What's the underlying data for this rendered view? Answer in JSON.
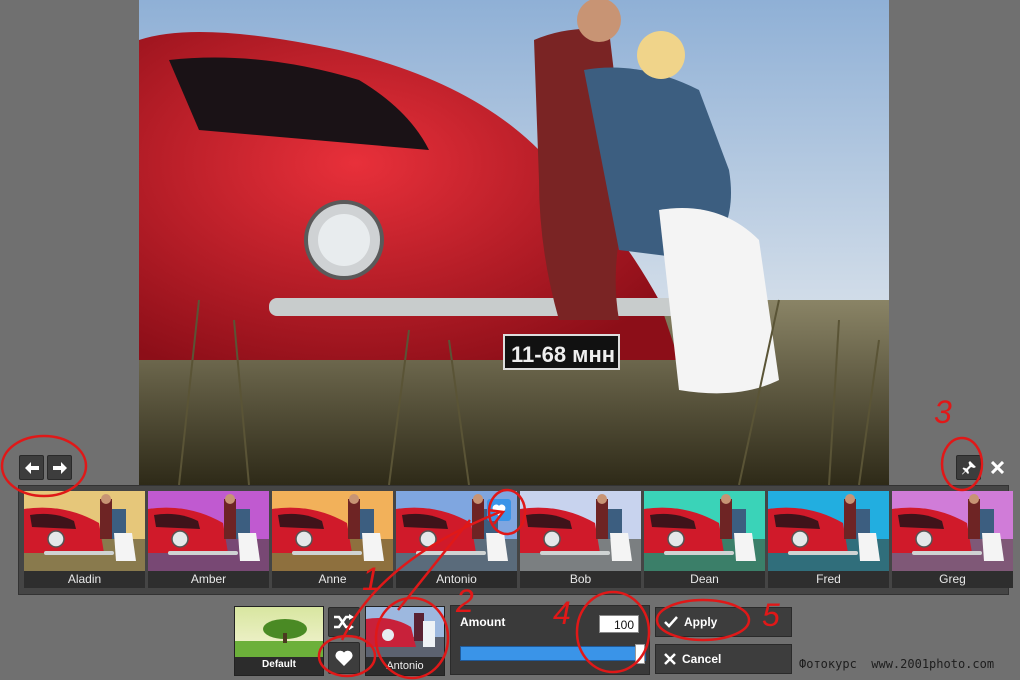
{
  "photo": {
    "plate_text": "11-68 мнн"
  },
  "nav": {
    "prev_icon": "arrow-left-icon",
    "next_icon": "arrow-right-icon"
  },
  "top_right": {
    "pin_icon": "pin-icon",
    "close_icon": "close-icon"
  },
  "filters": [
    {
      "label": "Aladin",
      "tint": "#e6c77a"
    },
    {
      "label": "Amber",
      "tint": "#c05ad0"
    },
    {
      "label": "Anne",
      "tint": "#f2b15a"
    },
    {
      "label": "Antonio",
      "tint": "#7fa6e0",
      "selected": true
    },
    {
      "label": "Bob",
      "tint": "#c8d3ee"
    },
    {
      "label": "Dean",
      "tint": "#3ad3b8"
    },
    {
      "label": "Fred",
      "tint": "#22aee0"
    },
    {
      "label": "Greg",
      "tint": "#d07cd8"
    }
  ],
  "controls": {
    "default_label": "Default",
    "shuffle_icon": "shuffle-icon",
    "favorite_icon": "heart-icon",
    "current_preset_label": "Antonio",
    "amount_label": "Amount",
    "amount_value": "100",
    "amount_level": 1.0,
    "apply_label": "Apply",
    "cancel_label": "Cancel"
  },
  "annotations": [
    "1",
    "2",
    "3",
    "4",
    "5"
  ],
  "watermark": "Фотокурс  www.2001photo.com",
  "colors": {
    "background": "#707070",
    "panel": "#3a3a3a",
    "accent": "#3a94e8",
    "annotation": "#e01818"
  }
}
